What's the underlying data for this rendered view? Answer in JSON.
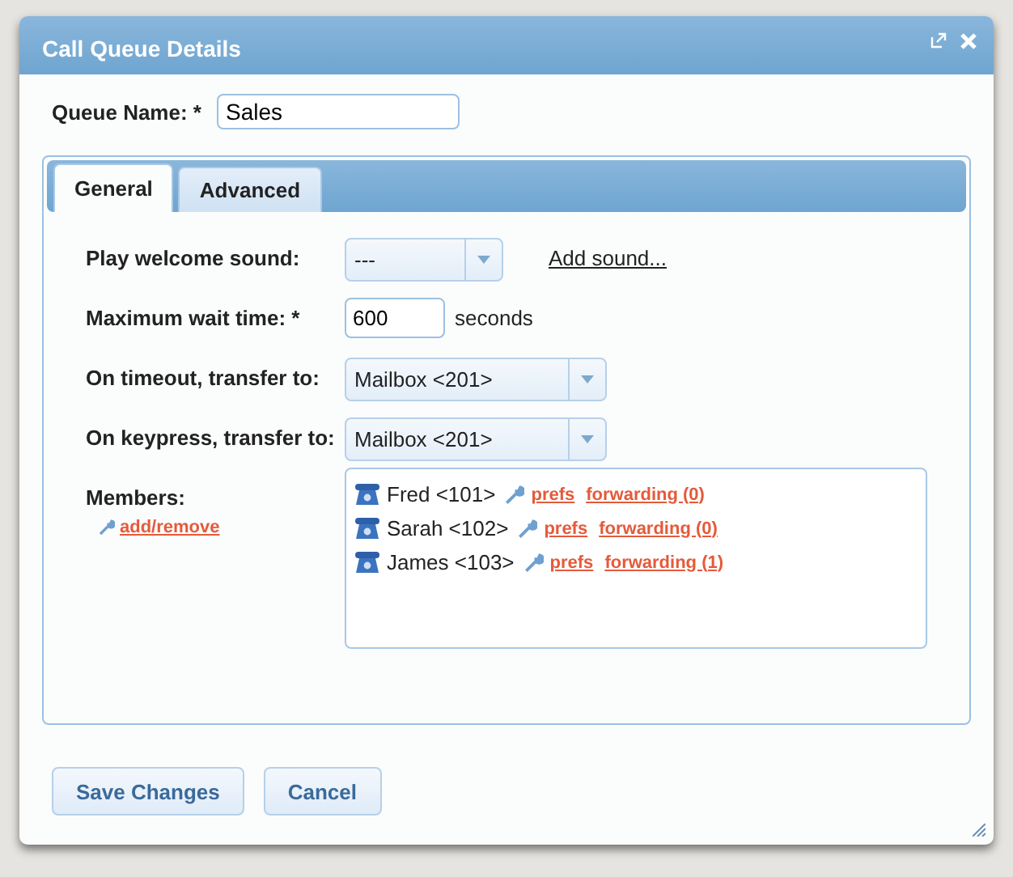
{
  "dialog": {
    "title": "Call Queue Details"
  },
  "queue_name": {
    "label": "Queue Name: *",
    "value": "Sales"
  },
  "tabs": [
    {
      "label": "General",
      "selected": true
    },
    {
      "label": "Advanced",
      "selected": false
    }
  ],
  "fields": [
    {
      "kind": "select",
      "label": "Play welcome sound:",
      "value": "---",
      "link": "Add sound..."
    },
    {
      "kind": "number",
      "label": "Maximum wait time: *",
      "value": "600",
      "unit": "seconds"
    },
    {
      "kind": "select",
      "label": "On timeout, transfer to:",
      "value": "Mailbox <201>"
    },
    {
      "kind": "select",
      "label": "On keypress, transfer to:",
      "value": "Mailbox <201>"
    }
  ],
  "members": {
    "label": "Members:",
    "edit_link": "add/remove",
    "items": [
      {
        "name": "Fred <101>",
        "prefs": "prefs",
        "forwarding": "forwarding (0)"
      },
      {
        "name": "Sarah <102>",
        "prefs": "prefs",
        "forwarding": "forwarding (0)"
      },
      {
        "name": "James <103>",
        "prefs": "prefs",
        "forwarding": "forwarding (1)"
      }
    ]
  },
  "buttons": [
    "Save Changes",
    "Cancel"
  ]
}
